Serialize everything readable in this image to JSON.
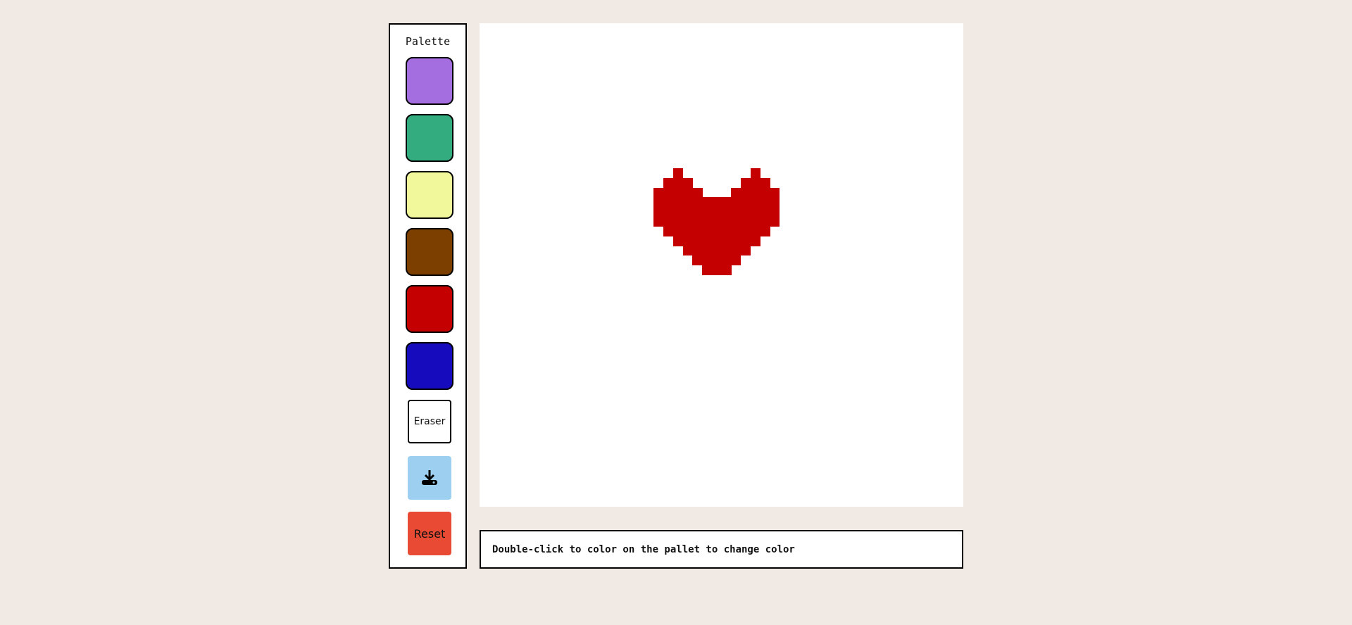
{
  "palette": {
    "title": "Palette",
    "colors": [
      {
        "name": "purple",
        "hex": "#a56ee0"
      },
      {
        "name": "green",
        "hex": "#33ad7f"
      },
      {
        "name": "yellow",
        "hex": "#f1f79b"
      },
      {
        "name": "brown",
        "hex": "#7d3f00"
      },
      {
        "name": "red",
        "hex": "#c40000"
      },
      {
        "name": "blue",
        "hex": "#170cbd"
      }
    ],
    "eraser_label": "Eraser",
    "download_icon": "download-icon",
    "reset_label": "Reset"
  },
  "canvas": {
    "grid_size": 50,
    "heart_color": "#c40000",
    "heart_cells": [
      [
        20,
        15
      ],
      [
        28,
        15
      ],
      [
        19,
        16
      ],
      [
        20,
        16
      ],
      [
        21,
        16
      ],
      [
        27,
        16
      ],
      [
        28,
        16
      ],
      [
        29,
        16
      ],
      [
        18,
        17
      ],
      [
        19,
        17
      ],
      [
        20,
        17
      ],
      [
        21,
        17
      ],
      [
        22,
        17
      ],
      [
        26,
        17
      ],
      [
        27,
        17
      ],
      [
        28,
        17
      ],
      [
        29,
        17
      ],
      [
        30,
        17
      ],
      [
        18,
        18
      ],
      [
        19,
        18
      ],
      [
        20,
        18
      ],
      [
        21,
        18
      ],
      [
        22,
        18
      ],
      [
        23,
        18
      ],
      [
        24,
        18
      ],
      [
        25,
        18
      ],
      [
        26,
        18
      ],
      [
        27,
        18
      ],
      [
        28,
        18
      ],
      [
        29,
        18
      ],
      [
        30,
        18
      ],
      [
        18,
        19
      ],
      [
        19,
        19
      ],
      [
        20,
        19
      ],
      [
        21,
        19
      ],
      [
        22,
        19
      ],
      [
        23,
        19
      ],
      [
        24,
        19
      ],
      [
        25,
        19
      ],
      [
        26,
        19
      ],
      [
        27,
        19
      ],
      [
        28,
        19
      ],
      [
        29,
        19
      ],
      [
        30,
        19
      ],
      [
        18,
        20
      ],
      [
        19,
        20
      ],
      [
        20,
        20
      ],
      [
        21,
        20
      ],
      [
        22,
        20
      ],
      [
        23,
        20
      ],
      [
        24,
        20
      ],
      [
        25,
        20
      ],
      [
        26,
        20
      ],
      [
        27,
        20
      ],
      [
        28,
        20
      ],
      [
        29,
        20
      ],
      [
        30,
        20
      ],
      [
        19,
        21
      ],
      [
        20,
        21
      ],
      [
        21,
        21
      ],
      [
        22,
        21
      ],
      [
        23,
        21
      ],
      [
        24,
        21
      ],
      [
        25,
        21
      ],
      [
        26,
        21
      ],
      [
        27,
        21
      ],
      [
        28,
        21
      ],
      [
        29,
        21
      ],
      [
        20,
        22
      ],
      [
        21,
        22
      ],
      [
        22,
        22
      ],
      [
        23,
        22
      ],
      [
        24,
        22
      ],
      [
        25,
        22
      ],
      [
        26,
        22
      ],
      [
        27,
        22
      ],
      [
        28,
        22
      ],
      [
        21,
        23
      ],
      [
        22,
        23
      ],
      [
        23,
        23
      ],
      [
        24,
        23
      ],
      [
        25,
        23
      ],
      [
        26,
        23
      ],
      [
        27,
        23
      ],
      [
        22,
        24
      ],
      [
        23,
        24
      ],
      [
        24,
        24
      ],
      [
        25,
        24
      ],
      [
        26,
        24
      ],
      [
        23,
        25
      ],
      [
        24,
        25
      ],
      [
        25,
        25
      ]
    ]
  },
  "hint": {
    "text": "Double-click to color on the pallet to change color"
  }
}
